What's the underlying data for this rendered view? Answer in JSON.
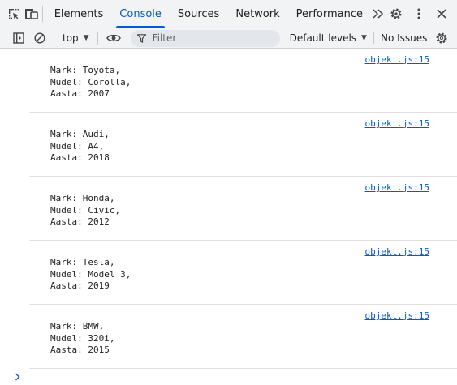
{
  "tabs": [
    {
      "label": "Elements"
    },
    {
      "label": "Console"
    },
    {
      "label": "Sources"
    },
    {
      "label": "Network"
    },
    {
      "label": "Performance"
    }
  ],
  "active_tab": "Console",
  "toolbar": {
    "context": "top",
    "filter_placeholder": "Filter",
    "levels": "Default levels",
    "issues": "No Issues"
  },
  "messages": [
    {
      "source": "objekt.js:15",
      "text": "Mark: Toyota,\nMudel: Corolla,\nAasta: 2007"
    },
    {
      "source": "objekt.js:15",
      "text": "Mark: Audi,\nMudel: A4,\nAasta: 2018"
    },
    {
      "source": "objekt.js:15",
      "text": "Mark: Honda,\nMudel: Civic,\nAasta: 2012"
    },
    {
      "source": "objekt.js:15",
      "text": "Mark: Tesla,\nMudel: Model 3,\nAasta: 2019"
    },
    {
      "source": "objekt.js:15",
      "text": "Mark: BMW,\nMudel: 320i,\nAasta: 2015"
    }
  ],
  "icons": {
    "inspect": "inspect-element-icon",
    "device": "device-toolbar-icon",
    "more_tabs": "chevron-double-right-icon",
    "settings": "gear-icon",
    "menu": "kebab-menu-icon",
    "close": "close-icon",
    "sidebar": "sidebar-toggle-icon",
    "clear": "clear-console-icon",
    "eye": "eye-icon",
    "filter": "filter-icon",
    "console_settings": "gear-icon",
    "prompt": "chevron-right-icon"
  },
  "colors": {
    "accent": "#0b57d0",
    "toolbar_bg": "#f1f3f4"
  }
}
